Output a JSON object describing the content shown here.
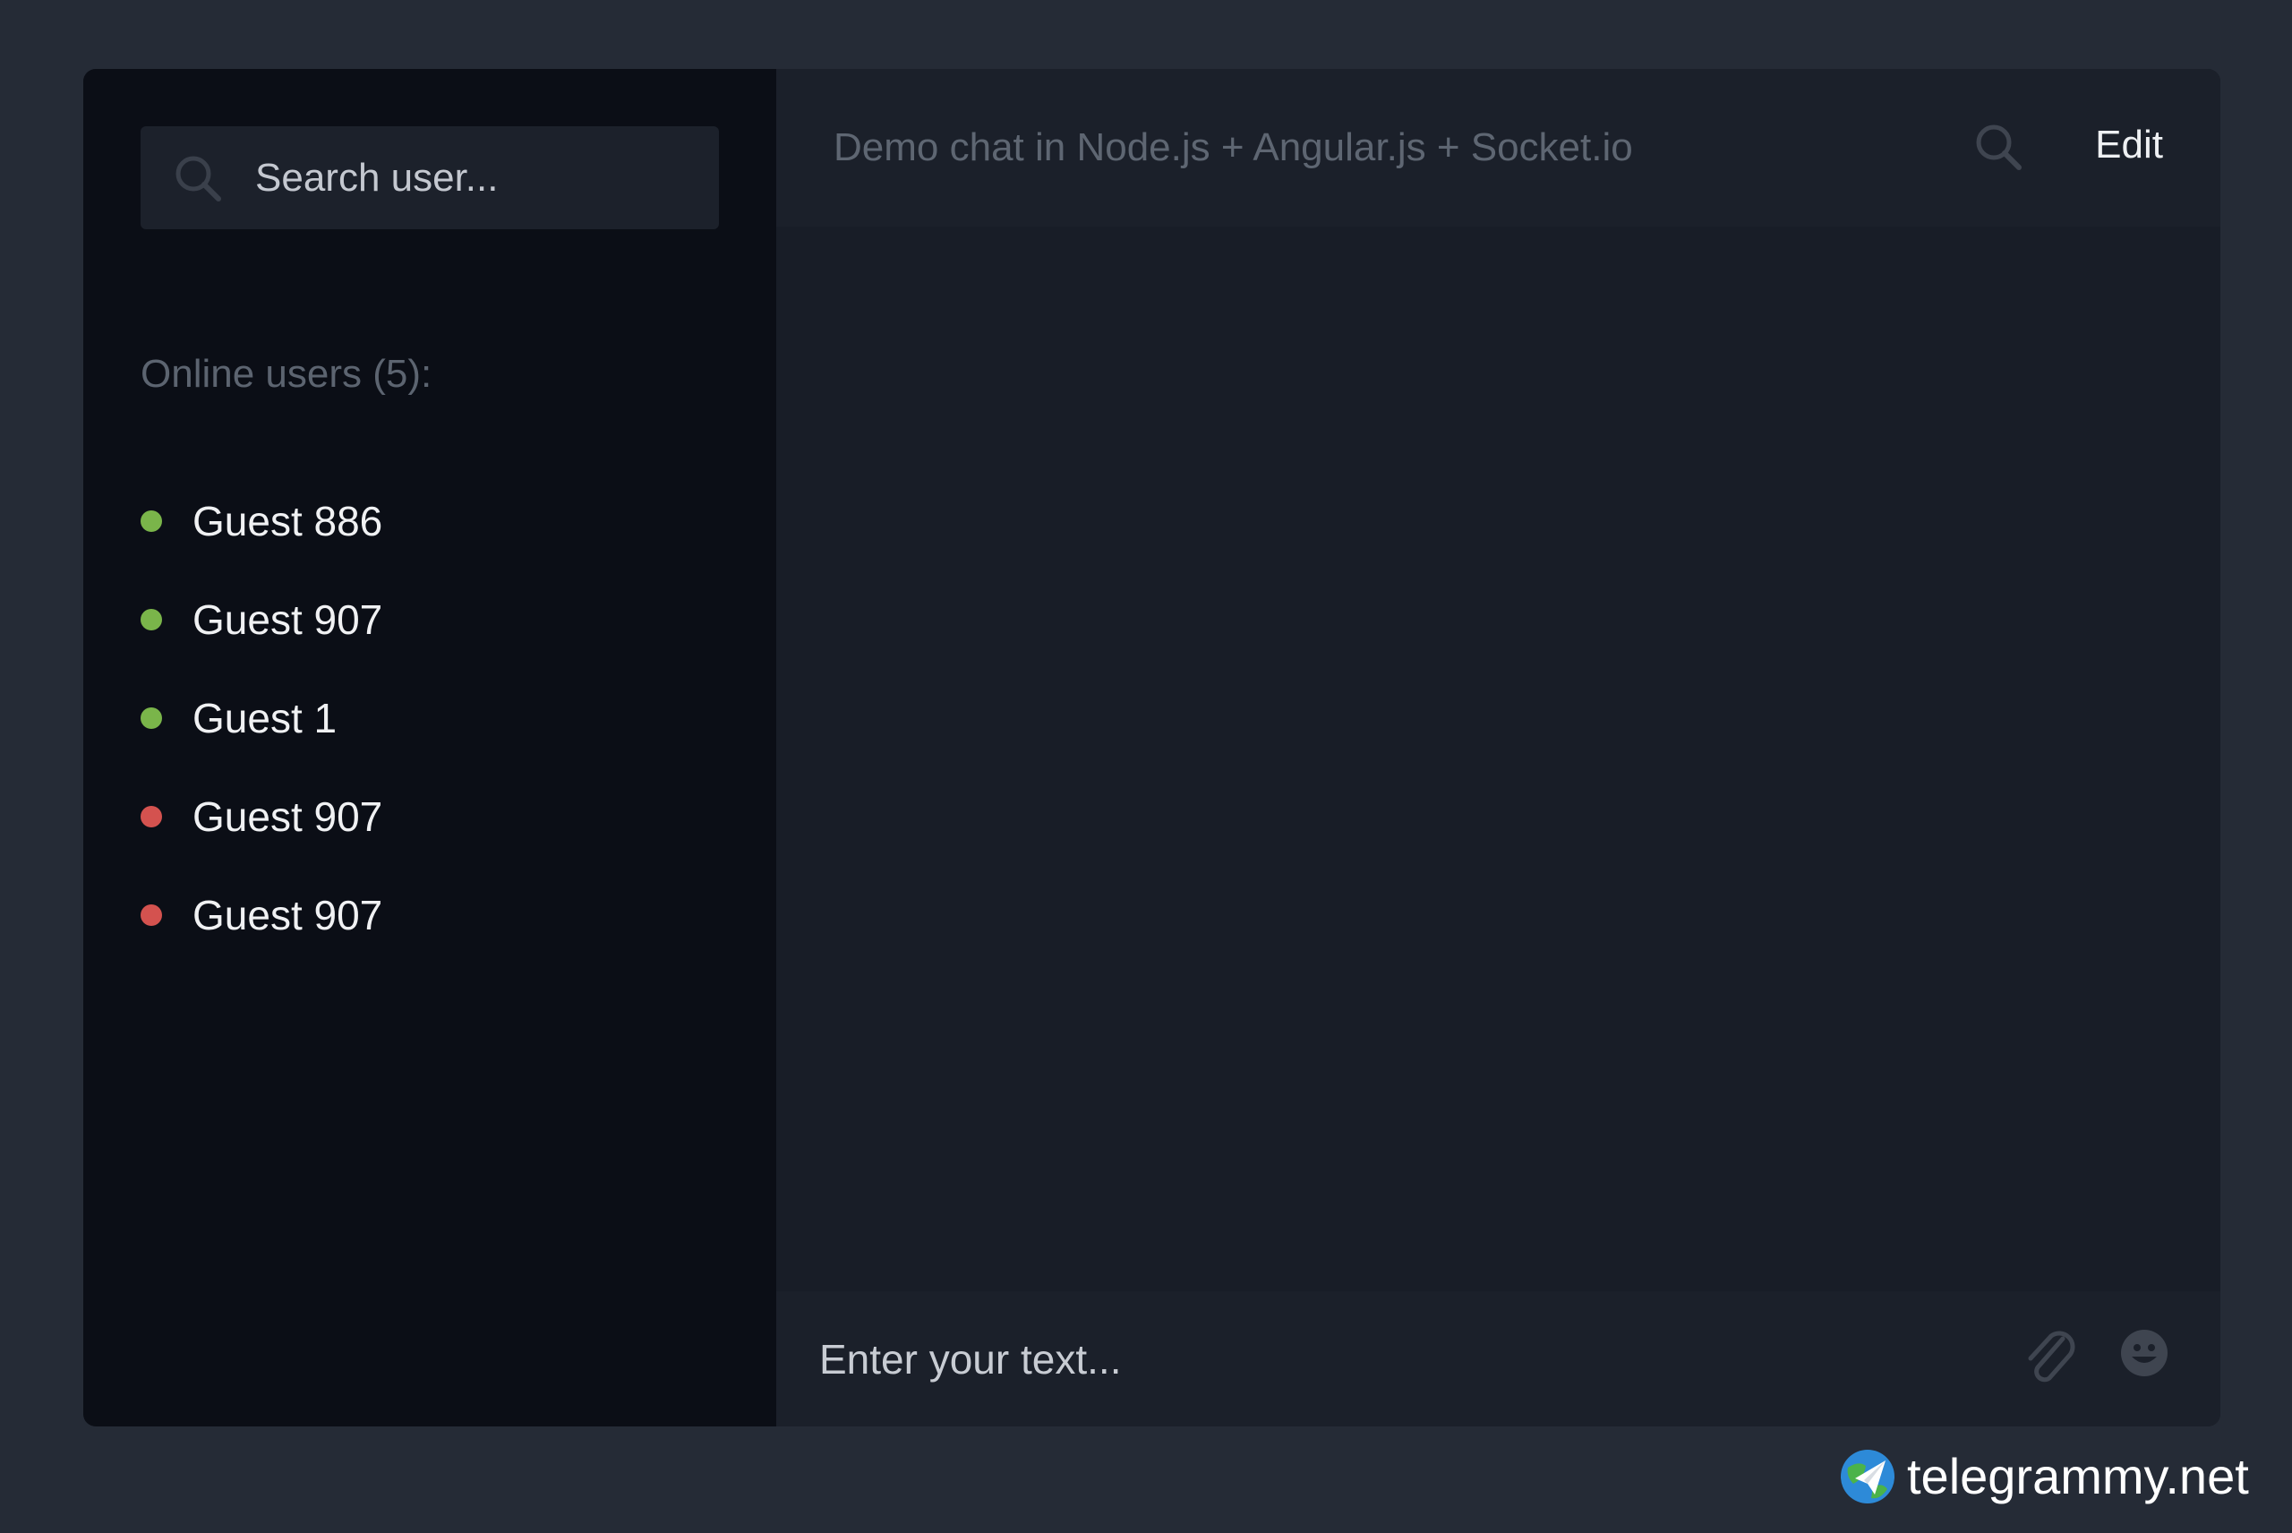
{
  "sidebar": {
    "search": {
      "placeholder": "Search user..."
    },
    "online_heading": "Online users (5):",
    "users": [
      {
        "name": "Guest 886",
        "status": "online",
        "color": "#7ab54a"
      },
      {
        "name": "Guest 907",
        "status": "online",
        "color": "#7ab54a"
      },
      {
        "name": "Guest 1",
        "status": "online",
        "color": "#7ab54a"
      },
      {
        "name": "Guest 907",
        "status": "offline",
        "color": "#d4524f"
      },
      {
        "name": "Guest 907",
        "status": "offline",
        "color": "#d4524f"
      }
    ]
  },
  "header": {
    "title": "Demo chat in Node.js + Angular.js + Socket.io",
    "search_icon": "search-icon",
    "edit_label": "Edit"
  },
  "composer": {
    "placeholder": "Enter your text...",
    "attach_icon": "paperclip-icon",
    "emoji_icon": "smiley-icon"
  },
  "watermark": {
    "text": "telegrammy.net"
  }
}
